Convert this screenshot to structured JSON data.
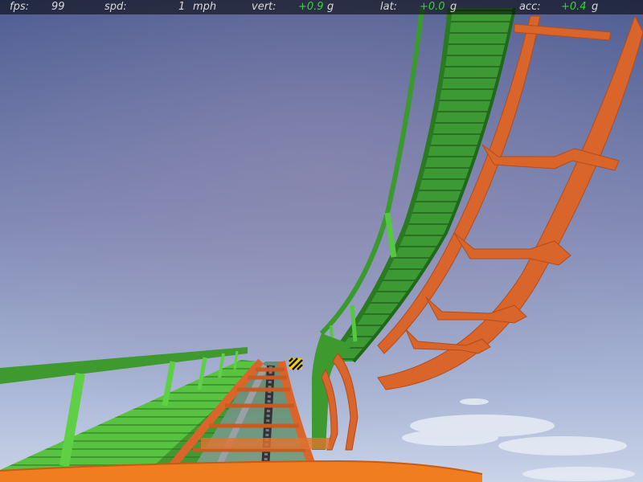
{
  "hud": {
    "fps_label": "fps:",
    "fps_value": "99",
    "spd_label": "spd:",
    "spd_value": "1",
    "spd_unit": "mph",
    "vert_label": "vert:",
    "vert_value": "+0.9",
    "vert_unit": "g",
    "lat_label": "lat:",
    "lat_value": "+0.0",
    "lat_unit": "g",
    "acc_label": "acc:",
    "acc_value": "+0.4",
    "acc_unit": "g"
  },
  "colors": {
    "sky_top": "#4f5f95",
    "sky_bottom": "#c7d2e6",
    "track_green": "#2f8a2a",
    "track_green_light": "#5fcf45",
    "support_orange": "#d9652a",
    "ground_orange": "#f07d20",
    "hud_value_green": "#37d23a"
  },
  "scene": {
    "warning_sign_icon": "hazard-stripe-icon"
  }
}
